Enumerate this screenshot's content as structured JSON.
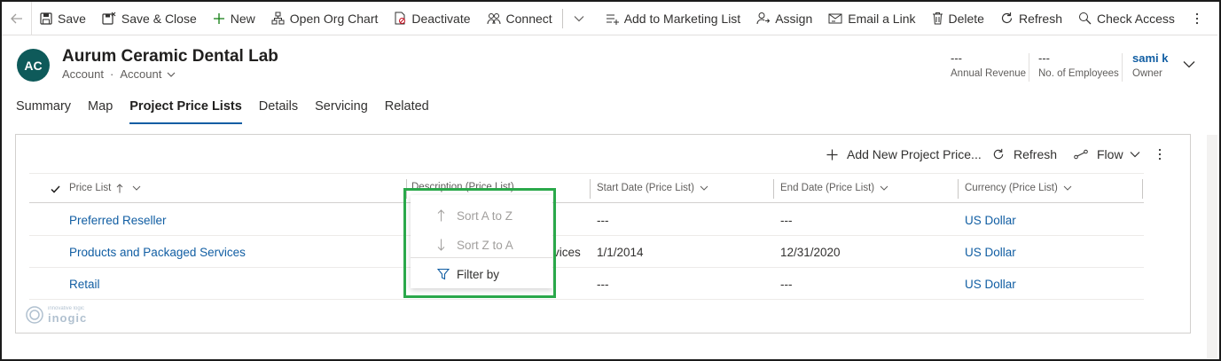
{
  "command_bar": {
    "items": [
      {
        "label": "Save",
        "icon": "save-icon"
      },
      {
        "label": "Save & Close",
        "icon": "save-close-icon"
      },
      {
        "label": "New",
        "icon": "plus-icon"
      },
      {
        "label": "Open Org Chart",
        "icon": "org-chart-icon"
      },
      {
        "label": "Deactivate",
        "icon": "deactivate-icon"
      },
      {
        "label": "Connect",
        "icon": "connect-icon"
      },
      {
        "label": "Add to Marketing List",
        "icon": "marketing-list-icon"
      },
      {
        "label": "Assign",
        "icon": "assign-icon"
      },
      {
        "label": "Email a Link",
        "icon": "email-link-icon"
      },
      {
        "label": "Delete",
        "icon": "trash-icon"
      },
      {
        "label": "Refresh",
        "icon": "refresh-icon"
      },
      {
        "label": "Check Access",
        "icon": "check-access-icon"
      }
    ]
  },
  "record": {
    "initials": "AC",
    "title": "Aurum Ceramic Dental Lab",
    "entity": "Account",
    "form": "Account"
  },
  "header_fields": [
    {
      "value": "---",
      "label": "Annual Revenue"
    },
    {
      "value": "---",
      "label": "No. of Employees"
    },
    {
      "value": "sami k",
      "label": "Owner"
    }
  ],
  "tabs": [
    "Summary",
    "Map",
    "Project Price Lists",
    "Details",
    "Servicing",
    "Related"
  ],
  "active_tab": "Project Price Lists",
  "grid": {
    "commands": {
      "add_new": "Add New Project Price...",
      "refresh": "Refresh",
      "flow": "Flow"
    },
    "columns": [
      "Price List",
      "Description (Price List)",
      "Start Date (Price List)",
      "End Date (Price List)",
      "Currency (Price List)"
    ],
    "rows": [
      {
        "price_list": "Preferred Reseller",
        "description": "",
        "start": "---",
        "end": "---",
        "currency": "US Dollar"
      },
      {
        "price_list": "Products and Packaged Services",
        "description": "vices",
        "start": "1/1/2014",
        "end": "12/31/2020",
        "currency": "US Dollar"
      },
      {
        "price_list": "Retail",
        "description": "",
        "start": "---",
        "end": "---",
        "currency": "US Dollar"
      }
    ]
  },
  "column_menu": {
    "sort_asc": "Sort A to Z",
    "sort_desc": "Sort Z to A",
    "filter": "Filter by"
  },
  "watermark": {
    "tagline": "innovative logic",
    "brand": "inogic"
  },
  "colors": {
    "accent": "#115ea3",
    "highlight": "#2aa84a",
    "avatar": "#0e5a5a"
  }
}
